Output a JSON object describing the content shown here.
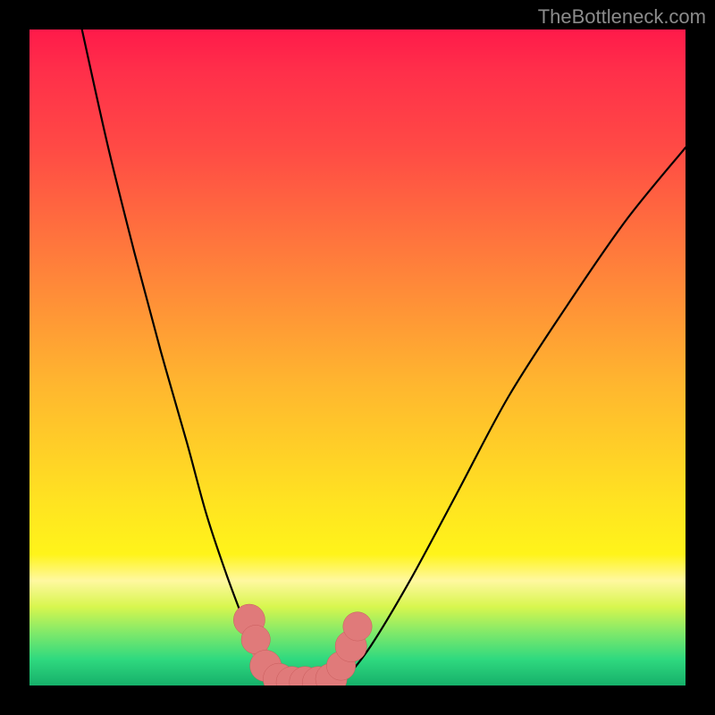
{
  "watermark": "TheBottleneck.com",
  "colors": {
    "background": "#000000",
    "gradient_top": "#ff1a4a",
    "gradient_mid1": "#ff7a3c",
    "gradient_mid2": "#ffe321",
    "gradient_bottom": "#16b06a",
    "curve": "#000000",
    "beads": "#e07a7a"
  },
  "chart_data": {
    "type": "line",
    "title": "",
    "xlabel": "",
    "ylabel": "",
    "xlim": [
      0,
      100
    ],
    "ylim": [
      0,
      100
    ],
    "grid": false,
    "curve_left": [
      {
        "x": 8,
        "y": 100
      },
      {
        "x": 12,
        "y": 82
      },
      {
        "x": 16,
        "y": 66
      },
      {
        "x": 20,
        "y": 51
      },
      {
        "x": 24,
        "y": 37
      },
      {
        "x": 27,
        "y": 26
      },
      {
        "x": 30,
        "y": 17
      },
      {
        "x": 33,
        "y": 9
      },
      {
        "x": 35,
        "y": 4
      },
      {
        "x": 37,
        "y": 1
      },
      {
        "x": 38,
        "y": 0
      }
    ],
    "trough": [
      {
        "x": 38,
        "y": 0
      },
      {
        "x": 42,
        "y": 0
      },
      {
        "x": 46,
        "y": 0
      }
    ],
    "curve_right": [
      {
        "x": 46,
        "y": 0
      },
      {
        "x": 48,
        "y": 1
      },
      {
        "x": 52,
        "y": 6
      },
      {
        "x": 58,
        "y": 16
      },
      {
        "x": 65,
        "y": 29
      },
      {
        "x": 73,
        "y": 44
      },
      {
        "x": 82,
        "y": 58
      },
      {
        "x": 91,
        "y": 71
      },
      {
        "x": 100,
        "y": 82
      }
    ],
    "beads": [
      {
        "x": 33.5,
        "y": 10,
        "r": 1.6
      },
      {
        "x": 34.5,
        "y": 7,
        "r": 1.4
      },
      {
        "x": 36.0,
        "y": 3,
        "r": 1.6
      },
      {
        "x": 38.0,
        "y": 1,
        "r": 1.6
      },
      {
        "x": 40.0,
        "y": 0.5,
        "r": 1.6
      },
      {
        "x": 42.0,
        "y": 0.5,
        "r": 1.6
      },
      {
        "x": 44.0,
        "y": 0.5,
        "r": 1.6
      },
      {
        "x": 46.0,
        "y": 1,
        "r": 1.6
      },
      {
        "x": 47.5,
        "y": 3,
        "r": 1.4
      },
      {
        "x": 49.0,
        "y": 6,
        "r": 1.6
      },
      {
        "x": 50.0,
        "y": 9,
        "r": 1.4
      }
    ]
  }
}
